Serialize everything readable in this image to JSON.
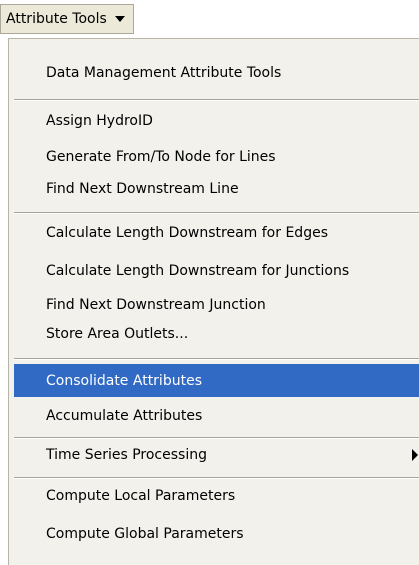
{
  "toolbar": {
    "menu_label": "Attribute Tools",
    "arrow_icon": "caret-down"
  },
  "menu": {
    "items": [
      {
        "label": "Data Management Attribute Tools"
      },
      {
        "label": "Assign HydroID"
      },
      {
        "label": "Generate From/To Node for Lines"
      },
      {
        "label": "Find Next Downstream Line"
      },
      {
        "label": "Calculate Length Downstream for Edges"
      },
      {
        "label": "Calculate Length Downstream for Junctions"
      },
      {
        "label": "Find Next Downstream Junction"
      },
      {
        "label": "Store Area Outlets..."
      },
      {
        "label": "Consolidate Attributes",
        "highlighted": true
      },
      {
        "label": "Accumulate Attributes"
      },
      {
        "label": "Time Series Processing",
        "submenu": true,
        "submenu_icon": "chevron-right"
      },
      {
        "label": "Compute Local Parameters"
      },
      {
        "label": "Compute Global Parameters"
      }
    ]
  },
  "colors": {
    "highlight_bg": "#316ac5",
    "highlight_text": "#ffffff",
    "menu_bg": "#f2f1ec"
  }
}
